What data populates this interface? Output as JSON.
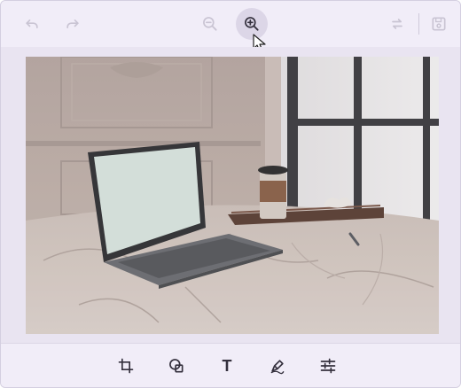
{
  "top_toolbar": {
    "buttons": [
      {
        "name": "undo",
        "icon": "undo-icon",
        "state": "disabled"
      },
      {
        "name": "redo",
        "icon": "redo-icon",
        "state": "disabled"
      },
      {
        "name": "zoom-out",
        "icon": "zoom-out-icon",
        "state": "disabled"
      },
      {
        "name": "zoom-in",
        "icon": "zoom-in-icon",
        "state": "hover"
      },
      {
        "name": "reset",
        "icon": "reset-icon",
        "state": "disabled"
      },
      {
        "name": "save",
        "icon": "save-icon",
        "state": "disabled"
      }
    ]
  },
  "image": {
    "description_icon": "photo-laptop-on-marble-table",
    "colors": {
      "wall": "#c9bbb3",
      "table": "#d8cdc6",
      "window_frame": "#3b3b3f",
      "screen": "#d9e6e1"
    }
  },
  "bottom_toolbar": {
    "tools": [
      {
        "name": "crop",
        "icon": "crop-icon"
      },
      {
        "name": "shapes",
        "icon": "shapes-icon"
      },
      {
        "name": "text",
        "icon": "text-icon",
        "glyph": "T"
      },
      {
        "name": "draw",
        "icon": "pen-icon"
      },
      {
        "name": "adjust",
        "icon": "sliders-icon"
      }
    ]
  },
  "colors": {
    "toolbar_bg": "#f1edf8",
    "canvas_bg": "#e9e4f1",
    "icon_enabled": "#34303d",
    "icon_disabled": "#c9c4d3",
    "hover_bg": "#dcd6e7"
  }
}
